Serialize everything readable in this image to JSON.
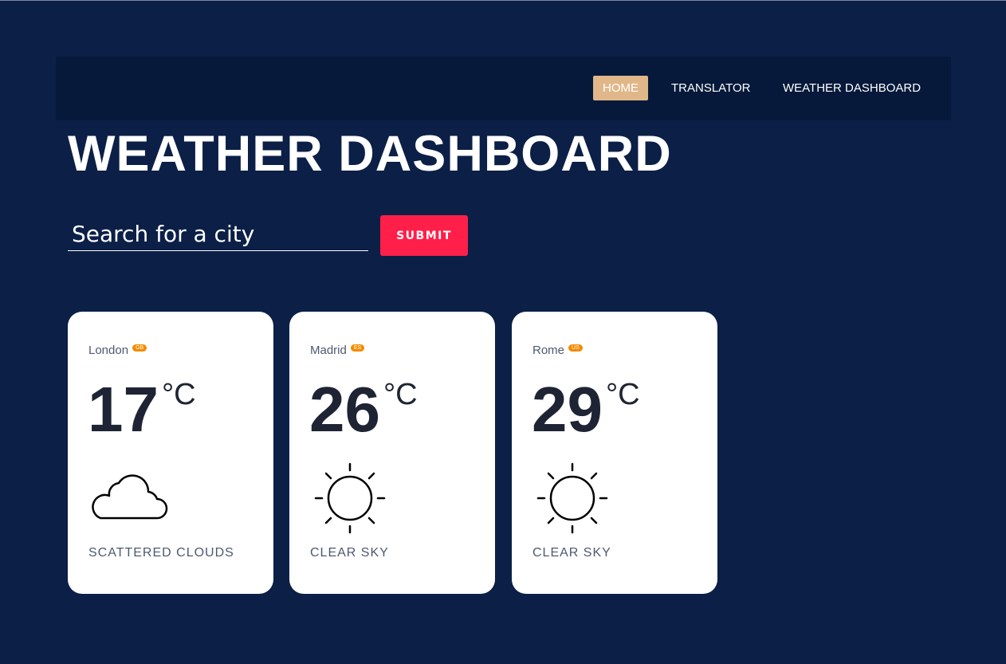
{
  "nav": {
    "items": [
      {
        "label": "HOME",
        "active": true
      },
      {
        "label": "TRANSLATOR",
        "active": false
      },
      {
        "label": "WEATHER DASHBOARD",
        "active": false
      }
    ]
  },
  "page": {
    "title": "WEATHER DASHBOARD"
  },
  "search": {
    "placeholder": "Search for a city",
    "value": "",
    "submit_label": "SUBMIT"
  },
  "cards": [
    {
      "city": "London",
      "country": "GB",
      "temperature": "17",
      "unit": "°C",
      "icon": "cloud-icon",
      "description": "SCATTERED CLOUDS"
    },
    {
      "city": "Madrid",
      "country": "ES",
      "temperature": "26",
      "unit": "°C",
      "icon": "sun-icon",
      "description": "CLEAR SKY"
    },
    {
      "city": "Rome",
      "country": "US",
      "temperature": "29",
      "unit": "°C",
      "icon": "sun-icon",
      "description": "CLEAR SKY"
    }
  ],
  "colors": {
    "background": "#0b1f47",
    "navbar": "#06193a",
    "nav_active": "#e0b788",
    "submit": "#ff1f48",
    "badge": "#f28b00",
    "card": "#ffffff",
    "temperature_text": "#1e2433",
    "secondary_text": "#4d5970"
  }
}
